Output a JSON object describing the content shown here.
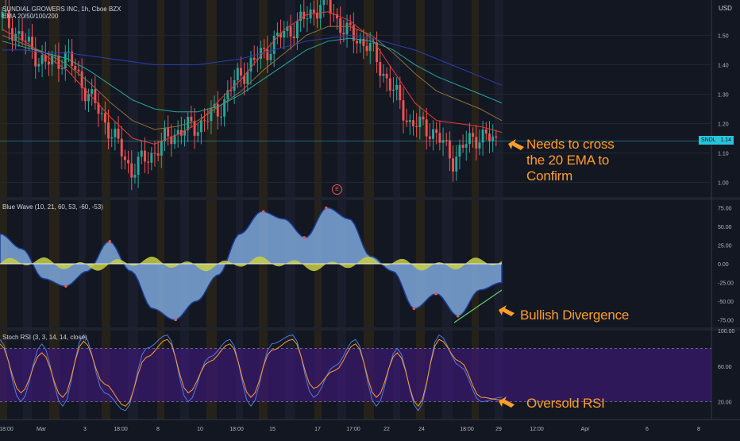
{
  "header": {
    "symbol_title": "SUNDIAL GROWERS INC, 1h, Cboe BZX",
    "ema_label": "EMA 20/50/100/200",
    "currency": "USD"
  },
  "panes": {
    "wave_label": "Blue Wave (10, 21, 60, 53, -60, -53)",
    "stoch_label": "Stoch RSI (3, 3, 14, 14, close)"
  },
  "price_tag": {
    "symbol": "SNDL",
    "value": "1.14"
  },
  "event_marker": "E",
  "annotations": {
    "ema_note": [
      "Needs to cross",
      "the 20 EMA to",
      "Confirm"
    ],
    "divergence_note": "Bullish Divergence",
    "oversold_note": "Oversold RSI"
  },
  "colors": {
    "background": "#131722",
    "candle_up": "#26a69a",
    "candle_down": "#ef5350",
    "ema20": "#e53935",
    "ema50": "#8d6e3a",
    "ema100": "#26a69a",
    "ema200": "#2a3fb0",
    "wave_fill": "#7fa8dc",
    "wave_yellow": "#c8d044",
    "stoch_k": "#4c7be0",
    "stoch_d": "#ff9d2b",
    "stoch_band": "#3a1a6e",
    "annotation": "#ff9d2b",
    "price_line": "#26c6da"
  },
  "icons": {
    "arrow": "left-arrow-icon"
  },
  "chart_data": [
    {
      "type": "candlestick",
      "name": "price",
      "y_ticks": [
        1.0,
        1.1,
        1.2,
        1.3,
        1.4,
        1.5
      ],
      "y_range": [
        0.95,
        1.62
      ],
      "last_price": 1.14,
      "series": [
        {
          "name": "EMA 20",
          "values": [
            1.52,
            1.48,
            1.43,
            1.38,
            1.3,
            1.22,
            1.15,
            1.13,
            1.16,
            1.2,
            1.28,
            1.35,
            1.44,
            1.52,
            1.57,
            1.58,
            1.55,
            1.49,
            1.38,
            1.27,
            1.21,
            1.2,
            1.19,
            1.17
          ]
        },
        {
          "name": "EMA 50",
          "values": [
            1.5,
            1.47,
            1.44,
            1.4,
            1.34,
            1.27,
            1.21,
            1.18,
            1.19,
            1.21,
            1.26,
            1.31,
            1.38,
            1.44,
            1.5,
            1.53,
            1.53,
            1.5,
            1.44,
            1.37,
            1.31,
            1.28,
            1.25,
            1.21
          ]
        },
        {
          "name": "EMA 100",
          "values": [
            1.48,
            1.46,
            1.44,
            1.42,
            1.38,
            1.33,
            1.28,
            1.25,
            1.24,
            1.24,
            1.26,
            1.3,
            1.35,
            1.4,
            1.45,
            1.48,
            1.49,
            1.48,
            1.45,
            1.4,
            1.36,
            1.33,
            1.3,
            1.27
          ]
        },
        {
          "name": "EMA 200",
          "values": [
            1.45,
            1.45,
            1.44,
            1.44,
            1.43,
            1.42,
            1.41,
            1.4,
            1.4,
            1.4,
            1.41,
            1.42,
            1.44,
            1.46,
            1.48,
            1.49,
            1.5,
            1.49,
            1.47,
            1.45,
            1.42,
            1.39,
            1.36,
            1.33
          ]
        }
      ],
      "close": [
        1.56,
        1.48,
        1.4,
        1.43,
        1.3,
        1.18,
        1.04,
        1.1,
        1.17,
        1.19,
        1.24,
        1.36,
        1.43,
        1.5,
        1.55,
        1.62,
        1.51,
        1.47,
        1.34,
        1.2,
        1.18,
        1.08,
        1.16,
        1.14
      ]
    },
    {
      "type": "area",
      "name": "Blue Wave",
      "y_ticks": [
        75,
        50,
        25,
        0,
        -25,
        -50,
        -75
      ],
      "y_range": [
        -85,
        85
      ],
      "values": [
        40,
        20,
        -20,
        -30,
        -10,
        30,
        -10,
        -60,
        -75,
        -50,
        -15,
        40,
        70,
        60,
        35,
        75,
        60,
        10,
        -10,
        -60,
        -40,
        -70,
        -35,
        -25
      ]
    },
    {
      "type": "line",
      "name": "Stoch RSI",
      "y_ticks": [
        100,
        60,
        20
      ],
      "y_range": [
        0,
        100
      ],
      "band": [
        20,
        80
      ],
      "series": [
        {
          "name": "%K",
          "values": [
            90,
            20,
            85,
            15,
            95,
            30,
            10,
            80,
            95,
            20,
            70,
            90,
            15,
            85,
            95,
            25,
            60,
            90,
            15,
            80,
            10,
            95,
            60,
            20,
            25
          ]
        },
        {
          "name": "%D",
          "values": [
            85,
            30,
            75,
            25,
            88,
            40,
            15,
            70,
            90,
            30,
            65,
            85,
            25,
            78,
            90,
            35,
            55,
            85,
            25,
            75,
            15,
            90,
            65,
            25,
            22
          ]
        }
      ]
    }
  ],
  "x_axis": {
    "labels": [
      "18:00",
      "Mar",
      "3",
      "18:00",
      "8",
      "10",
      "18:00",
      "15",
      "17",
      "17:00",
      "22",
      "24",
      "18:00",
      "29",
      "12:00",
      "Apr",
      "6",
      "8"
    ]
  }
}
